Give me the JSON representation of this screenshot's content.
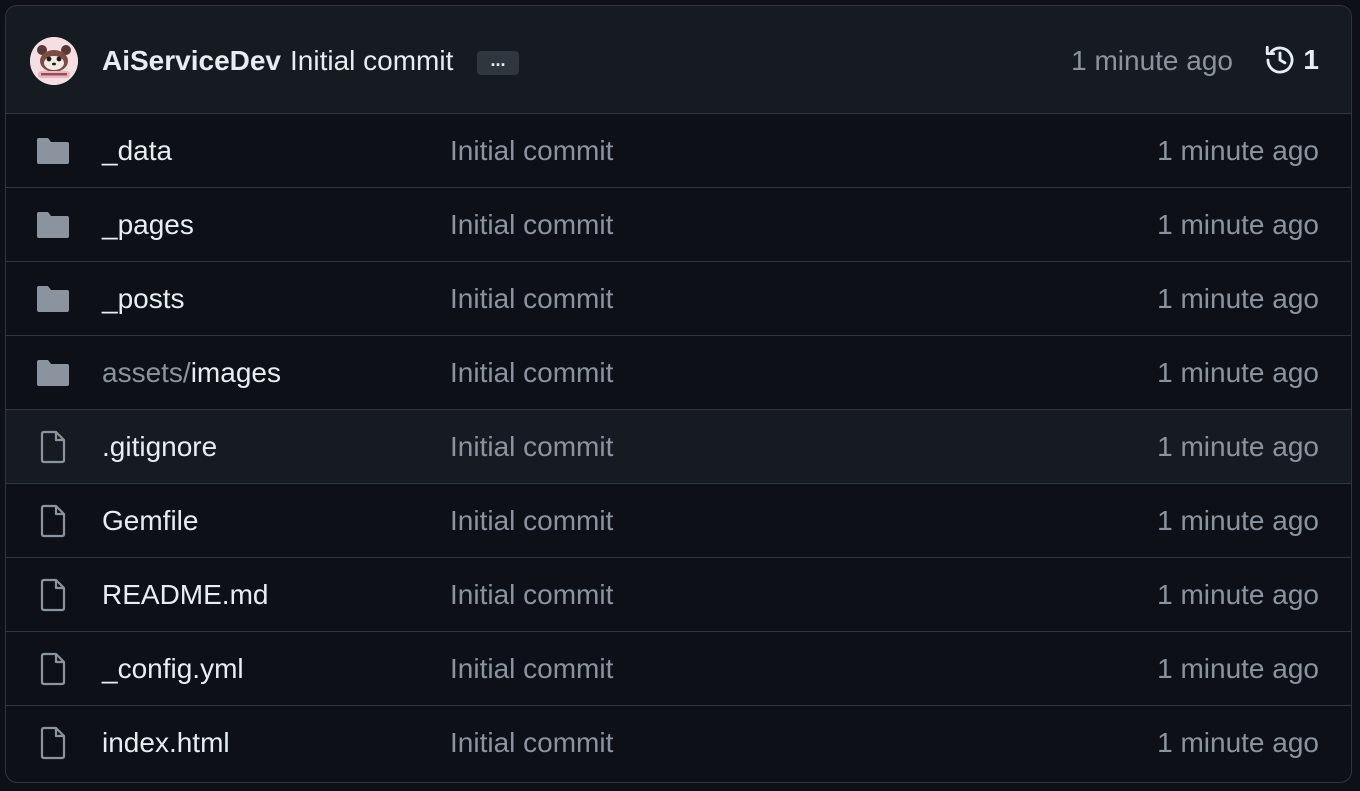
{
  "latest_commit": {
    "author": "AiServiceDev",
    "message": "Initial commit",
    "ellipsis": "...",
    "time": "1 minute ago",
    "history_count": "1"
  },
  "files": [
    {
      "type": "folder",
      "prefix": "",
      "name": "_data",
      "message": "Initial commit",
      "time": "1 minute ago"
    },
    {
      "type": "folder",
      "prefix": "",
      "name": "_pages",
      "message": "Initial commit",
      "time": "1 minute ago"
    },
    {
      "type": "folder",
      "prefix": "",
      "name": "_posts",
      "message": "Initial commit",
      "time": "1 minute ago"
    },
    {
      "type": "folder",
      "prefix": "assets/",
      "name": "images",
      "message": "Initial commit",
      "time": "1 minute ago"
    },
    {
      "type": "file",
      "prefix": "",
      "name": ".gitignore",
      "message": "Initial commit",
      "time": "1 minute ago"
    },
    {
      "type": "file",
      "prefix": "",
      "name": "Gemfile",
      "message": "Initial commit",
      "time": "1 minute ago"
    },
    {
      "type": "file",
      "prefix": "",
      "name": "README.md",
      "message": "Initial commit",
      "time": "1 minute ago"
    },
    {
      "type": "file",
      "prefix": "",
      "name": "_config.yml",
      "message": "Initial commit",
      "time": "1 minute ago"
    },
    {
      "type": "file",
      "prefix": "",
      "name": "index.html",
      "message": "Initial commit",
      "time": "1 minute ago"
    }
  ],
  "colors": {
    "background": "#0d1117",
    "header_bg": "#161b22",
    "border": "#30363d",
    "text": "#e6edf3",
    "muted": "#8b949e",
    "icon": "#8b949e"
  },
  "icons": {
    "folder": "folder-icon",
    "file": "file-icon",
    "history": "history-icon"
  }
}
